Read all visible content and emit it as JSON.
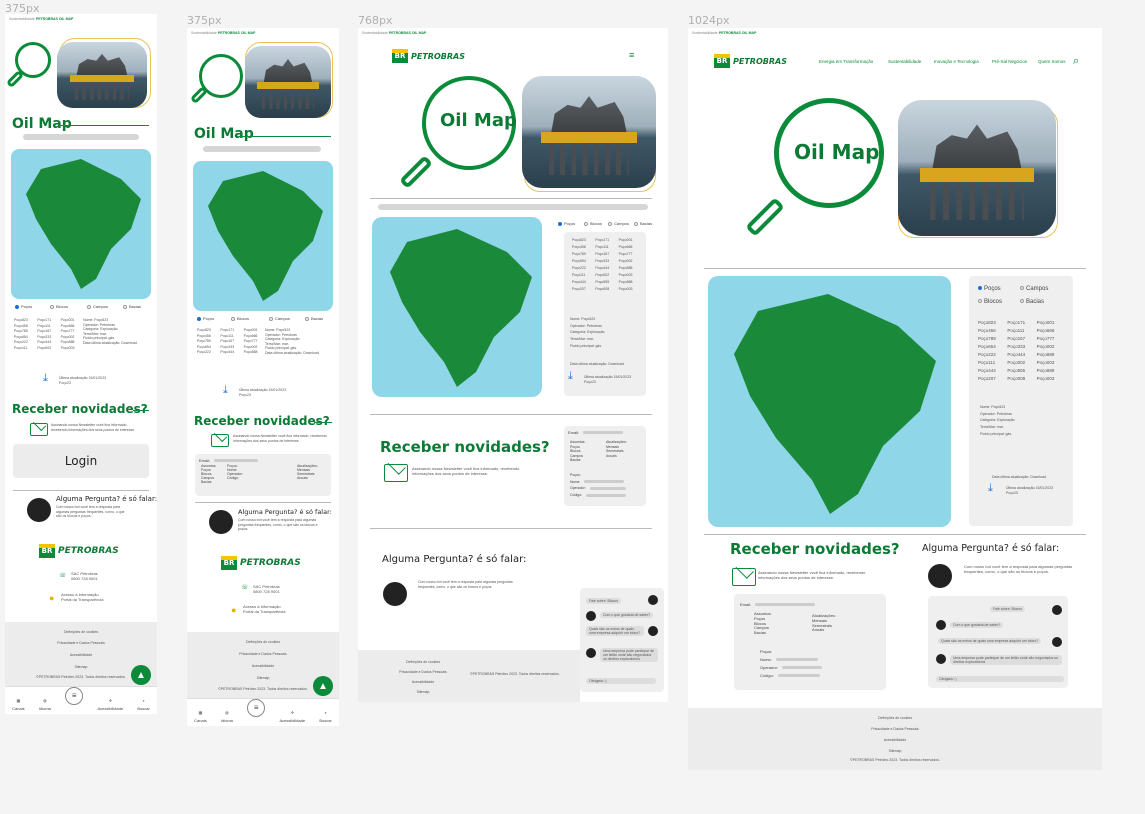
{
  "frames": [
    {
      "label": "375px"
    },
    {
      "label": "375px"
    },
    {
      "label": "768px"
    },
    {
      "label": "1024px"
    }
  ],
  "breadcrumb": {
    "prefix": "Sustentabilidade",
    "current": "PETROBRAS OIL MAP"
  },
  "brand": {
    "logo_mark": "BR",
    "wordmark": "PETROBRAS"
  },
  "hero": {
    "title": "Oil Map"
  },
  "nav": [
    "Energia em Transformação",
    "Sustentabilidade",
    "Inovação e Tecnologia",
    "Pré-Sal Negócios",
    "Quem Somos"
  ],
  "filters": {
    "options": [
      "Poços",
      "Blocos",
      "Campos",
      "Bacias"
    ],
    "selected": "Poços"
  },
  "wells": [
    "Poço823",
    "Poço171",
    "Poço001",
    "Poço456",
    "Poço111",
    "Poço666",
    "Poço789",
    "Poço167",
    "Poço777",
    "Poço654",
    "Poço333",
    "Poço002",
    "Poço222",
    "Poço444",
    "Poço888",
    "Poço111",
    "Poço002",
    "Poço003",
    "Poço444",
    "Poço555",
    "Poço888",
    "Poço207",
    "Poço008",
    "Poço003"
  ],
  "well_details": [
    "Nome: Poço523",
    "Operador: Petrobras",
    "Categoria: Exploração",
    "Terra/Mar: mar.",
    "Fluido principal: gás.",
    "Data última atualização: Download"
  ],
  "update_info": {
    "line1": "Última atualização 15/01/2023",
    "line2": "Poço23"
  },
  "newsletter": {
    "title": "Receber novidades?",
    "text": "Assinando nossa Newsletter você fica informado, recebendo informações dos seus pontos de interesse.",
    "email_label": "Email:",
    "subjects_label": "Assuntos:",
    "subjects": [
      "Poços",
      "Blocos",
      "Campos",
      "Bacias"
    ],
    "updates_label": "Atualizações:",
    "updates": [
      "Mensais",
      "Semestrais",
      "Anuais"
    ],
    "wells_label": "Poços:",
    "fields": [
      "Nome:",
      "Operador:",
      "Código:"
    ]
  },
  "login": {
    "label": "Login"
  },
  "question": {
    "title": "Alguma Pergunta? é só falar:",
    "text": "Com nosso bot você tem a resposta para algumas perguntas frequentes, como, o que são os blocos e poços."
  },
  "chat": [
    "Fale sobre: Blocos",
    "Com o que gostaria de saber?",
    "Quais são os meios de quais uma empresa adquirir um bloco?",
    "Uma empresa pode participar de um leilão onde são negociados os direitos exploratórios",
    "Obrigado :)"
  ],
  "contact": {
    "sac": "SAC Petrobras",
    "phone": "0800 728 9001",
    "access_info": "Acesso à Informação",
    "transparency": "Portal da Transparência"
  },
  "footer": {
    "links": [
      "Definições de cookies",
      "Privacidade e Dados Pessoais",
      "Acessibilidade",
      "Sitemap"
    ],
    "copyright": "©PETROBRAS Petróleo 2023. Todos direitos reservados."
  },
  "bottom_nav": [
    "Canais",
    "Idioma",
    "Acessibilidade",
    "Buscar"
  ],
  "colors": {
    "brand_green": "#0b8a3a",
    "brand_yellow": "#f5c400",
    "map_water": "#8fd7e8",
    "map_land": "#1a8a3a"
  }
}
